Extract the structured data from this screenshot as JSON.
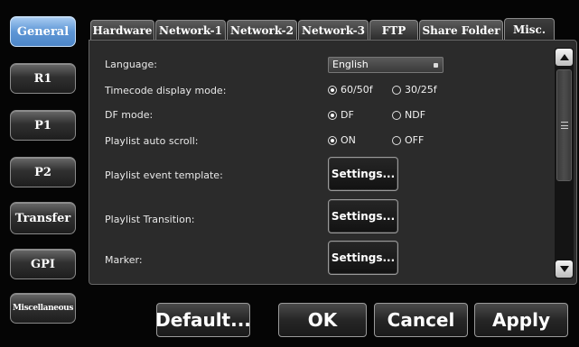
{
  "nav": {
    "items": [
      {
        "label": "General",
        "active": true
      },
      {
        "label": "R1"
      },
      {
        "label": "P1"
      },
      {
        "label": "P2"
      },
      {
        "label": "Transfer"
      },
      {
        "label": "GPI"
      },
      {
        "label": "Miscellaneous"
      }
    ]
  },
  "tabs": [
    {
      "label": "Hardware"
    },
    {
      "label": "Network-1"
    },
    {
      "label": "Network-2"
    },
    {
      "label": "Network-3"
    },
    {
      "label": "FTP"
    },
    {
      "label": "Share Folder"
    },
    {
      "label": "Misc.",
      "active": true
    }
  ],
  "settings": {
    "language": {
      "label": "Language:",
      "value": "English"
    },
    "timecode": {
      "label": "Timecode display mode:",
      "option_a": "60/50f",
      "option_b": "30/25f",
      "selected": "60/50f"
    },
    "df_mode": {
      "label": "DF mode:",
      "option_a": "DF",
      "option_b": "NDF",
      "selected": "DF"
    },
    "autoscroll": {
      "label": "Playlist auto scroll:",
      "option_a": "ON",
      "option_b": "OFF",
      "selected": "ON"
    },
    "event_template": {
      "label": "Playlist event template:",
      "button": "Settings..."
    },
    "transition": {
      "label": "Playlist Transition:",
      "button": "Settings..."
    },
    "marker": {
      "label": "Marker:",
      "button": "Settings..."
    }
  },
  "footer": {
    "default": "Default...",
    "ok": "OK",
    "cancel": "Cancel",
    "apply": "Apply"
  },
  "colors": {
    "active_nav": "#5f97d6",
    "panel_bg": "#2b2b2b",
    "background": "#050505"
  },
  "icons": {
    "scroll_up": "triangle-up-icon",
    "scroll_down": "triangle-down-icon",
    "scroll_grip": "grip-lines-icon",
    "dropdown": "chevron-down-icon"
  }
}
